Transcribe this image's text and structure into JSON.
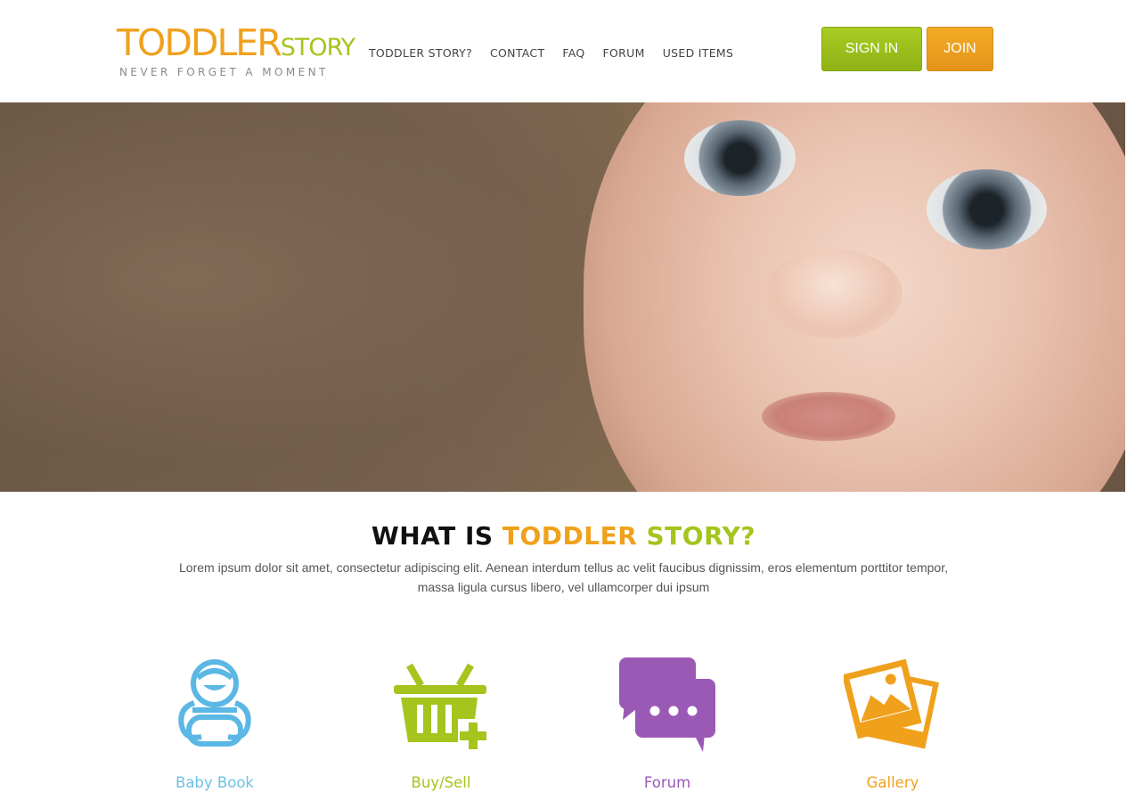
{
  "brand": {
    "logo_word1": "TODDLER",
    "logo_word2": "STORY",
    "tagline": "NEVER FORGET A MOMENT",
    "colors": {
      "orange": "#f0a11c",
      "green": "#a5c41d",
      "blue": "#6cc2e6",
      "purple": "#9b59b6"
    }
  },
  "nav": {
    "items": [
      {
        "label": "TODDLER STORY?"
      },
      {
        "label": "CONTACT"
      },
      {
        "label": "FAQ"
      },
      {
        "label": "FORUM"
      },
      {
        "label": "USED ITEMS"
      }
    ]
  },
  "auth": {
    "signin_label": "SIGN IN",
    "join_label": "JOIN"
  },
  "hero": {
    "image": "baby-face-photo"
  },
  "intro": {
    "title_part1": "WHAT IS ",
    "title_part2": "TODDLER",
    "title_part3": " STORY?",
    "text": "Lorem ipsum dolor sit amet, consectetur adipiscing elit. Aenean interdum tellus ac velit faucibus dignissim, eros elementum porttitor tempor, massa ligula cursus libero, vel ullamcorper dui ipsum"
  },
  "features": [
    {
      "label": "Baby Book",
      "icon": "baby-icon"
    },
    {
      "label": "Buy/Sell",
      "icon": "basket-icon"
    },
    {
      "label": "Forum",
      "icon": "chat-bubbles-icon"
    },
    {
      "label": "Gallery",
      "icon": "photos-icon"
    }
  ]
}
